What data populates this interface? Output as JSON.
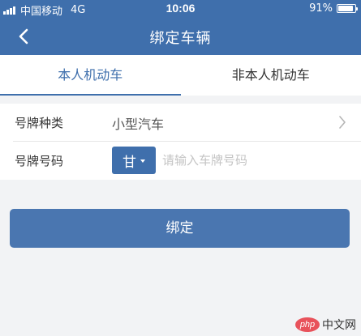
{
  "status_bar": {
    "carrier": "中国移动",
    "network": "4G",
    "time": "10:06",
    "battery_text": "91%",
    "battery_level": 0.91
  },
  "nav": {
    "title": "绑定车辆",
    "back_icon": "chevron-left-icon"
  },
  "tabs": [
    {
      "label": "本人机动车",
      "active": true
    },
    {
      "label": "非本人机动车",
      "active": false
    }
  ],
  "form": {
    "plate_type": {
      "label": "号牌种类",
      "value": "小型汽车"
    },
    "plate_number": {
      "label": "号牌号码",
      "province": "甘",
      "placeholder": "请输入车牌号码",
      "value": ""
    }
  },
  "bind_button": {
    "label": "绑定"
  },
  "watermark": {
    "logo": "php",
    "text": "中文网"
  },
  "colors": {
    "primary": "#3f6fac",
    "button": "#4a76b0",
    "background": "#f2f3f5"
  }
}
